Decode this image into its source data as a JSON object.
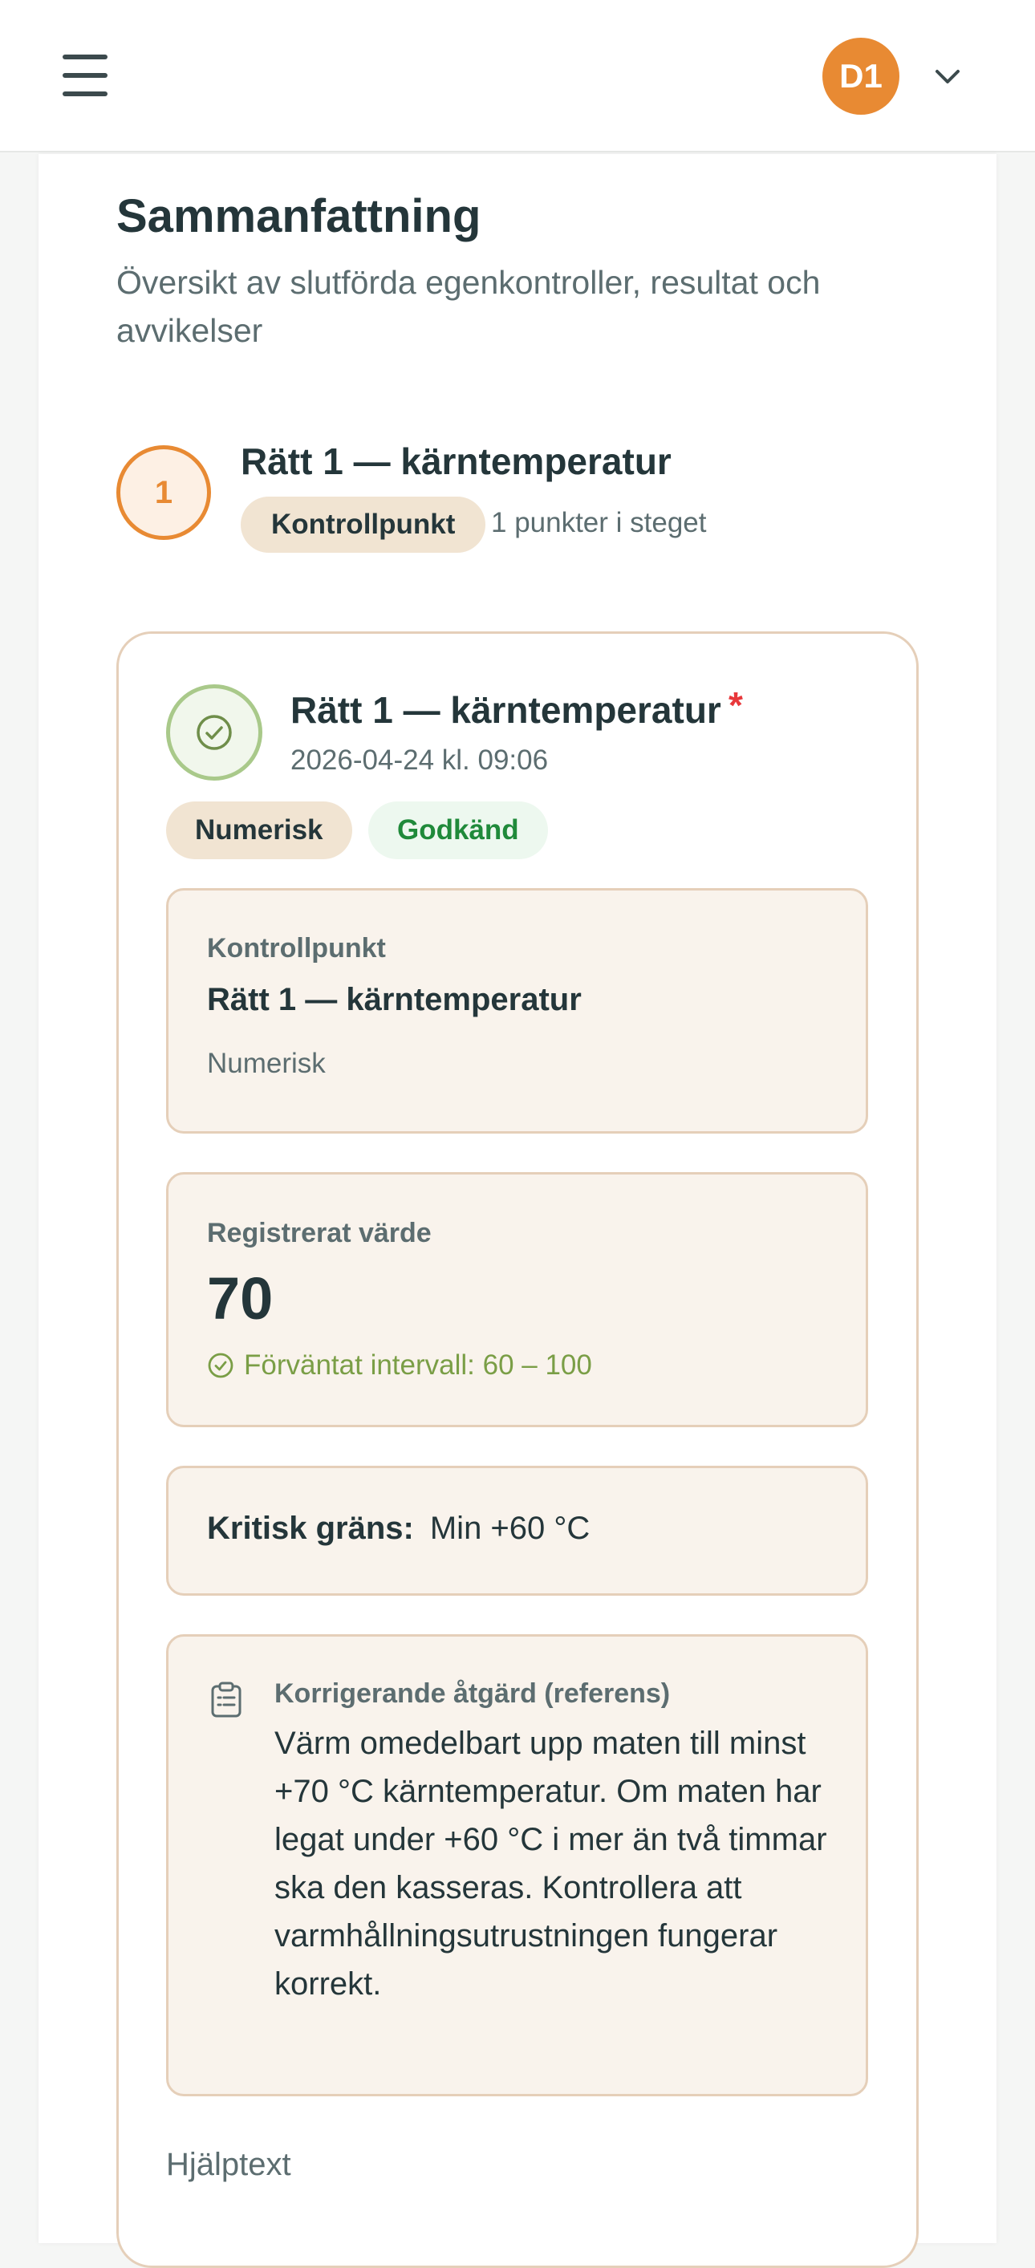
{
  "header": {
    "menu_icon": "hamburger-menu-icon",
    "avatar_initials": "D1",
    "avatar_color": "#e88a33",
    "dropdown_icon": "chevron-down-icon"
  },
  "page": {
    "title": "Sammanfattning",
    "subtitle": "Översikt av slutförda egenkontroller, resultat och avvikelser"
  },
  "step": {
    "number": "1",
    "title": "Rätt 1 — kärntemperatur",
    "chip": "Kontrollpunkt",
    "count_text": "1 punkter i steget",
    "accent_color": "#e88a33"
  },
  "item": {
    "title": "Rätt 1 — kärntemperatur",
    "required_marker": "*",
    "timestamp": "2026-04-24 kl. 09:06",
    "type_badge": "Numerisk",
    "status_badge": "Godkänd",
    "status_color": "#1f8a3a",
    "status_icon": "check-circle-icon",
    "checkpoint": {
      "label": "Kontrollpunkt",
      "name": "Rätt 1 — kärntemperatur",
      "type": "Numerisk"
    },
    "recorded": {
      "label": "Registrerat värde",
      "value": "70",
      "range_text": "Förväntat intervall: 60 – 100",
      "range_color": "#7a9e46"
    },
    "critical": {
      "label": "Kritisk gräns:",
      "value": "Min +60 °C"
    },
    "corrective": {
      "icon": "clipboard-list-icon",
      "label": "Korrigerande åtgärd (referens)",
      "text": "Värm omedelbart upp maten till minst +70 °C kärntemperatur. Om maten har legat under +60 °C i mer än två timmar ska den kasseras. Kontrollera att varmhållningsutrustningen fungerar korrekt."
    },
    "help_label": "Hjälptext"
  }
}
